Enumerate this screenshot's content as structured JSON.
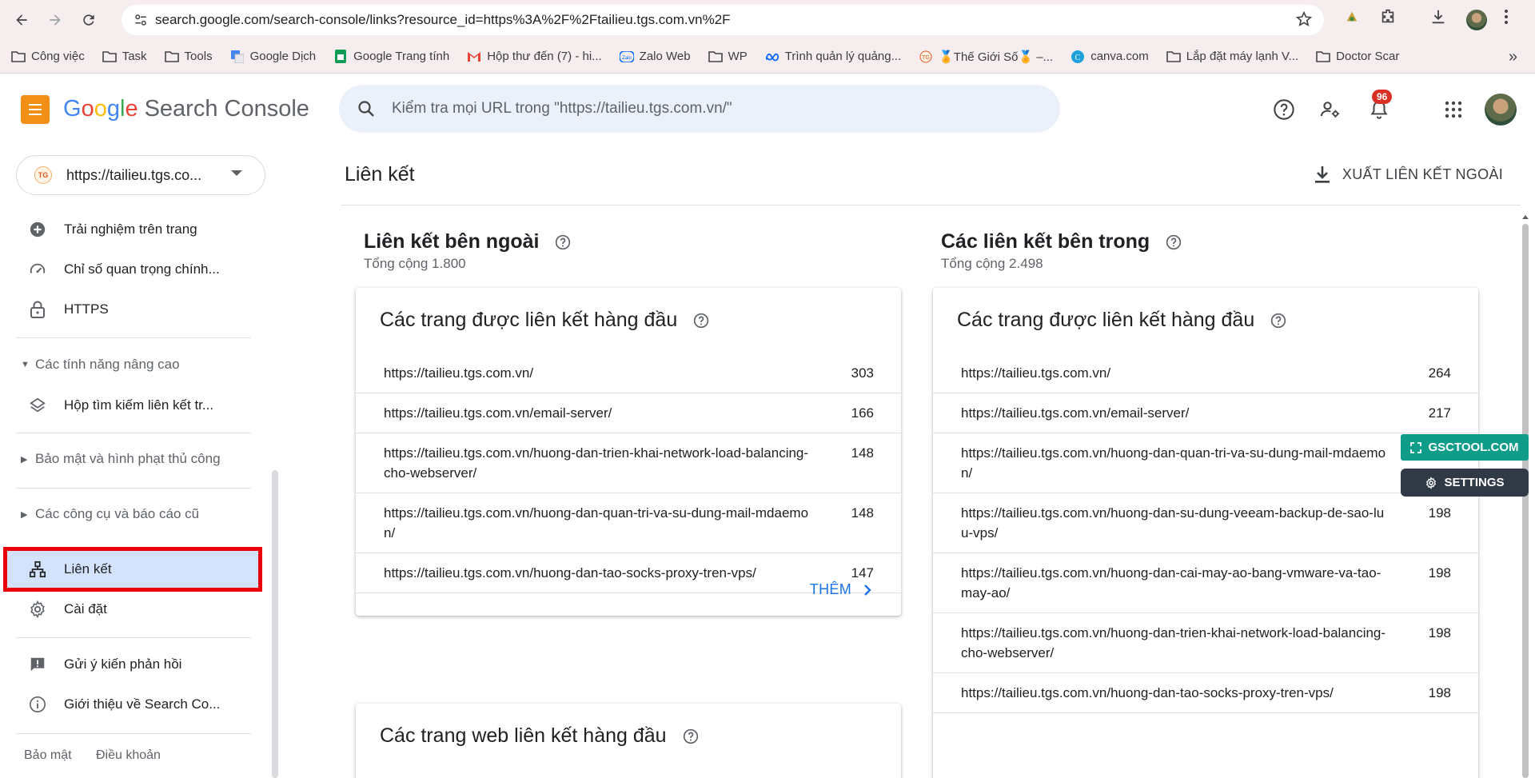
{
  "browser": {
    "url": "search.google.com/search-console/links?resource_id=https%3A%2F%2Ftailieu.tgs.com.vn%2F",
    "bookmarks": [
      {
        "label": "Công việc",
        "icon": "folder-icon"
      },
      {
        "label": "Task",
        "icon": "folder-icon"
      },
      {
        "label": "Tools",
        "icon": "folder-icon"
      },
      {
        "label": "Google Dịch",
        "icon": "google-translate-icon"
      },
      {
        "label": "Google Trang tính",
        "icon": "google-sheets-icon"
      },
      {
        "label": "Hộp thư đến (7) - hi...",
        "icon": "gmail-icon"
      },
      {
        "label": "Zalo Web",
        "icon": "zalo-icon"
      },
      {
        "label": "WP",
        "icon": "folder-icon"
      },
      {
        "label": "Trình quản lý quảng...",
        "icon": "meta-icon"
      },
      {
        "label": "🏅Thế Giới Số🏅 –...",
        "icon": "site-icon"
      },
      {
        "label": "canva.com",
        "icon": "canva-icon"
      },
      {
        "label": "Lắp đặt máy lạnh V...",
        "icon": "folder-icon"
      },
      {
        "label": "Doctor Scar",
        "icon": "folder-icon"
      }
    ]
  },
  "header": {
    "logo_google": [
      "G",
      "o",
      "o",
      "g",
      "l",
      "e"
    ],
    "logo_product": "Search Console",
    "search_placeholder": "Kiểm tra mọi URL trong \"https://tailieu.tgs.com.vn/\"",
    "notification_count": "96"
  },
  "sidebar": {
    "property": "https://tailieu.tgs.co...",
    "property_favicon_text": "TG",
    "items_top": [
      {
        "label": "Trải nghiệm trên trang",
        "icon": "plus-circle-icon"
      },
      {
        "label": "Chỉ số quan trọng chính...",
        "icon": "gauge-icon"
      },
      {
        "label": "HTTPS",
        "icon": "lock-icon"
      }
    ],
    "group_enhancements": "Các tính năng nâng cao",
    "item_sitelinks": "Hộp tìm kiếm liên kết tr...",
    "group_security": "Bảo mật và hình phạt thủ công",
    "group_legacy": "Các công cụ và báo cáo cũ",
    "item_links": "Liên kết",
    "item_settings": "Cài đặt",
    "item_feedback": "Gửi ý kiến phản hồi",
    "item_about": "Giới thiệu về Search Co...",
    "footer_privacy": "Bảo mật",
    "footer_terms": "Điều khoản"
  },
  "main": {
    "title": "Liên kết",
    "export_label": "XUẤT LIÊN KẾT NGOÀI",
    "external": {
      "title": "Liên kết bên ngoài",
      "total": "Tổng cộng 1.800",
      "top_pages_title": "Các trang được liên kết hàng đầu",
      "rows": [
        {
          "url": "https://tailieu.tgs.com.vn/",
          "count": "303"
        },
        {
          "url": "https://tailieu.tgs.com.vn/email-server/",
          "count": "166"
        },
        {
          "url": "https://tailieu.tgs.com.vn/huong-dan-trien-khai-network-load-balancing-cho-webserver/",
          "count": "148"
        },
        {
          "url": "https://tailieu.tgs.com.vn/huong-dan-quan-tri-va-su-dung-mail-mdaemon/",
          "count": "148"
        },
        {
          "url": "https://tailieu.tgs.com.vn/huong-dan-tao-socks-proxy-tren-vps/",
          "count": "147"
        }
      ],
      "more_label": "THÊM",
      "top_sites_title": "Các trang web liên kết hàng đầu"
    },
    "internal": {
      "title": "Các liên kết bên trong",
      "total": "Tổng cộng 2.498",
      "top_pages_title": "Các trang được liên kết hàng đầu",
      "rows": [
        {
          "url": "https://tailieu.tgs.com.vn/",
          "count": "264"
        },
        {
          "url": "https://tailieu.tgs.com.vn/email-server/",
          "count": "217"
        },
        {
          "url": "https://tailieu.tgs.com.vn/huong-dan-quan-tri-va-su-dung-mail-mdaemon/",
          "count": ""
        },
        {
          "url": "https://tailieu.tgs.com.vn/huong-dan-su-dung-veeam-backup-de-sao-luu-vps/",
          "count": "198"
        },
        {
          "url": "https://tailieu.tgs.com.vn/huong-dan-cai-may-ao-bang-vmware-va-tao-may-ao/",
          "count": "198"
        },
        {
          "url": "https://tailieu.tgs.com.vn/huong-dan-trien-khai-network-load-balancing-cho-webserver/",
          "count": "198"
        },
        {
          "url": "https://tailieu.tgs.com.vn/huong-dan-tao-socks-proxy-tren-vps/",
          "count": "198"
        }
      ]
    }
  },
  "extension": {
    "tool_label": "GSCTOOL.COM",
    "settings_label": "SETTINGS"
  },
  "colors": {
    "accent": "#1a73e8",
    "selected_bg": "#d3e3fd",
    "highlight_border": "#e8000b",
    "menu_button": "#f28f16"
  }
}
